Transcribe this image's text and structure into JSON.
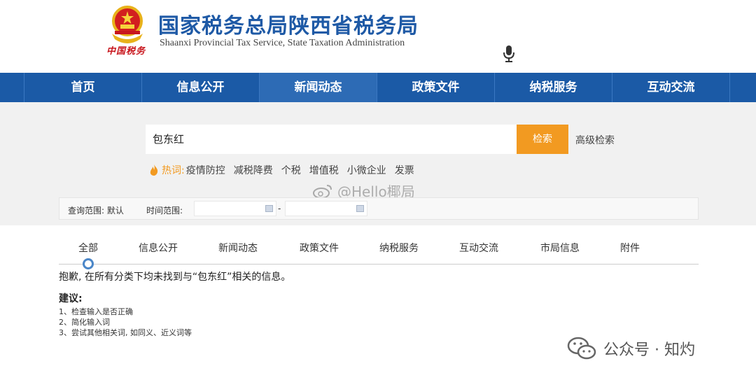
{
  "header": {
    "title": "国家税务总局陕西省税务局",
    "subtitle": "Shaanxi Provincial Tax Service, State Taxation Administration",
    "seal_text": "中国税务"
  },
  "nav": {
    "items": [
      {
        "label": "首页"
      },
      {
        "label": "信息公开"
      },
      {
        "label": "新闻动态"
      },
      {
        "label": "政策文件"
      },
      {
        "label": "纳税服务"
      },
      {
        "label": "互动交流"
      }
    ]
  },
  "search": {
    "value": "包东红",
    "button_label": "检索",
    "advanced_label": "高级检索",
    "hot_label": "热词:",
    "hot_tags": [
      "疫情防控",
      "减税降费",
      "个税",
      "增值税",
      "小微企业",
      "发票"
    ]
  },
  "filter": {
    "scope_label": "查询范围: 默认",
    "time_label": "时间范围:",
    "separator": "-"
  },
  "tabs": {
    "items": [
      {
        "label": "全部"
      },
      {
        "label": "信息公开"
      },
      {
        "label": "新闻动态"
      },
      {
        "label": "政策文件"
      },
      {
        "label": "纳税服务"
      },
      {
        "label": "互动交流"
      },
      {
        "label": "市局信息"
      },
      {
        "label": "附件"
      }
    ],
    "active": "全部"
  },
  "result": {
    "message": "抱歉, 在所有分类下均未找到与“包东红”相关的信息。",
    "tips_title": "建议:",
    "tips": [
      "1、检查输入是否正确",
      "2、简化输入词",
      "3、尝试其他相关词, 如同义、近义词等"
    ]
  },
  "watermarks": {
    "weibo": "@Hello椰局",
    "wechat": "公众号 · 知灼"
  },
  "colors": {
    "nav_bg": "#1b5aa6",
    "title_blue": "#1f5aa6",
    "accent_orange": "#f29a21",
    "band_bg": "#f1f1f1"
  },
  "icons": [
    "national-emblem-icon",
    "microphone-icon",
    "flame-icon",
    "calendar-icon",
    "weibo-icon",
    "wechat-icon"
  ]
}
